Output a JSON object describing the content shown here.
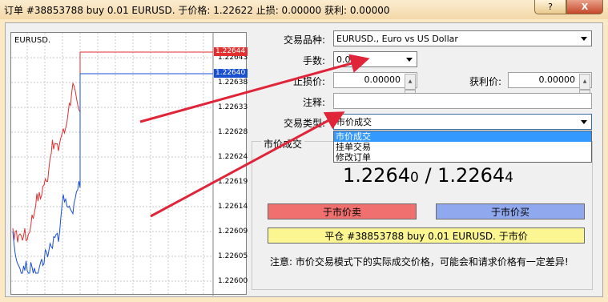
{
  "window": {
    "title": "订单 #38853788 buy 0.01 EURUSD. 于价格: 1.22622 止损: 0.00000 获利: 0.00000",
    "help_label": "?",
    "close_label": "X"
  },
  "chart": {
    "symbol": "EURUSD.",
    "y_ticks": [
      "1.22643",
      "1.22638",
      "1.22633",
      "1.22628",
      "1.22624",
      "1.22619",
      "1.22614",
      "1.22609",
      "1.22605",
      "1.22600"
    ],
    "ask_tag": "1.22644",
    "bid_tag": "1.22640",
    "colors": {
      "ask": "#e03030",
      "bid": "#1a4fd0"
    }
  },
  "form": {
    "symbol_label": "交易品种:",
    "symbol_value": "EURUSD., Euro vs US Dollar",
    "volume_label": "手数:",
    "volume_value": "0.01",
    "sl_label": "止损价:",
    "sl_value": "0.00000",
    "tp_label": "获利价:",
    "tp_value": "0.00000",
    "comment_label": "注释:",
    "comment_value": "",
    "type_label": "交易类型:",
    "type_value": "市价成交",
    "type_options": [
      "市价成交",
      "挂单交易",
      "修改订单"
    ]
  },
  "market": {
    "group_title": "市价成交",
    "bid": "1.22640",
    "ask": "1.22644",
    "sell_label": "于市价卖",
    "buy_label": "于市价买",
    "close_label": "平仓 #38853788 buy 0.01 EURUSD. 于市价",
    "note": "注意: 市价交易模式下的实际成交价格，可能会和请求价格有一定差异!"
  }
}
